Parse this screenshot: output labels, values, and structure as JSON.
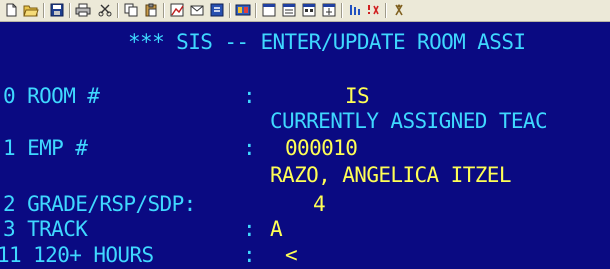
{
  "toolbar": {
    "buttons": [
      {
        "icon": "new-icon"
      },
      {
        "icon": "open-folder-icon"
      },
      {
        "icon": "save-icon"
      },
      {
        "icon": "print-icon"
      },
      {
        "icon": "cut-icon"
      },
      {
        "icon": "copy-icon"
      },
      {
        "icon": "paste-icon"
      },
      {
        "icon": "chart-icon"
      },
      {
        "icon": "send-icon"
      },
      {
        "icon": "receive-icon"
      },
      {
        "icon": "macro-icon"
      },
      {
        "icon": "session-icon"
      },
      {
        "icon": "display-icon"
      },
      {
        "icon": "keyboard-icon"
      },
      {
        "icon": "printer-setup-icon"
      },
      {
        "icon": "transfer-icon"
      },
      {
        "icon": "disconnect-icon"
      },
      {
        "icon": "help-icon"
      }
    ]
  },
  "screen": {
    "title": "*** SIS -- ENTER/UPDATE ROOM ASSI",
    "room": {
      "label": "0 ROOM #",
      "colon": ":",
      "value": "IS"
    },
    "assigned_header": "CURRENTLY ASSIGNED TEAC",
    "emp": {
      "label": "1 EMP #",
      "colon": ":",
      "value": "000010"
    },
    "teacher_name": "RAZO, ANGELICA ITZEL",
    "grade": {
      "label": "2 GRADE/RSP/SDP:",
      "value": "4"
    },
    "track": {
      "label": "3 TRACK",
      "colon": ":",
      "value": "A"
    },
    "hours": {
      "label": "11 120+ HOURS",
      "colon": ":",
      "value": "<"
    }
  },
  "colors": {
    "background": "#0a0a82",
    "label_text": "#3fd8ff",
    "value_text": "#ffff55",
    "toolbar": "#ece9d8"
  }
}
